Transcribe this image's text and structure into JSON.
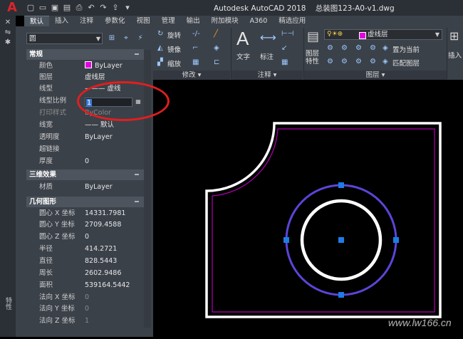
{
  "app": {
    "logo": "A",
    "title": "Autodesk AutoCAD 2018",
    "filename": "总装图123-A0-v1.dwg",
    "accent_color": "#d9252a"
  },
  "tabs": [
    {
      "label": "默认",
      "active": true
    },
    {
      "label": "插入"
    },
    {
      "label": "注释"
    },
    {
      "label": "参数化"
    },
    {
      "label": "视图"
    },
    {
      "label": "管理"
    },
    {
      "label": "输出"
    },
    {
      "label": "附加模块"
    },
    {
      "label": "A360"
    },
    {
      "label": "精选应用"
    }
  ],
  "ribbon": {
    "modify": {
      "rotate": "旋转",
      "mirror": "镜像",
      "scale": "缩放",
      "panel_label": "修改",
      "panel_arrow": "▾"
    },
    "annotation": {
      "text": "文字",
      "dimension": "标注",
      "panel_label": "注释",
      "panel_arrow": "▾"
    },
    "layers": {
      "layer_properties": "图层\n特性",
      "current_layer": "虚线层",
      "set_current": "置为当前",
      "match_layer": "匹配图层",
      "panel_label": "图层",
      "panel_arrow": "▾"
    },
    "insert": {
      "label": "插入"
    }
  },
  "palette": {
    "object_type": "圆",
    "side_label": "特性",
    "sections": {
      "general": "常规",
      "three_d": "三维效果",
      "geometry": "几何图形"
    },
    "general_rows": [
      {
        "label": "颜色",
        "value": "ByLayer",
        "swatch": "#e000e0"
      },
      {
        "label": "图层",
        "value": "虚线层"
      },
      {
        "label": "线型",
        "value": "———   虚线"
      },
      {
        "label": "线型比例",
        "value": "1"
      },
      {
        "label": "打印样式",
        "value": "ByColor"
      },
      {
        "label": "线宽",
        "value": "—— 默认"
      },
      {
        "label": "透明度",
        "value": "ByLayer"
      },
      {
        "label": "超链接",
        "value": ""
      },
      {
        "label": "厚度",
        "value": "0"
      }
    ],
    "three_d_rows": [
      {
        "label": "材质",
        "value": "ByLayer"
      }
    ],
    "geometry_rows": [
      {
        "label": "圆心 X 坐标",
        "value": "14331.7981"
      },
      {
        "label": "圆心 Y 坐标",
        "value": "2709.4588"
      },
      {
        "label": "圆心 Z 坐标",
        "value": "0"
      },
      {
        "label": "半径",
        "value": "414.2721"
      },
      {
        "label": "直径",
        "value": "828.5443"
      },
      {
        "label": "周长",
        "value": "2602.9486"
      },
      {
        "label": "面积",
        "value": "539164.5442"
      },
      {
        "label": "法向 X 坐标",
        "value": "0"
      },
      {
        "label": "法向 Y 坐标",
        "value": "0"
      },
      {
        "label": "法向 Z 坐标",
        "value": "1"
      }
    ]
  },
  "watermark": "www.lw166.cn"
}
